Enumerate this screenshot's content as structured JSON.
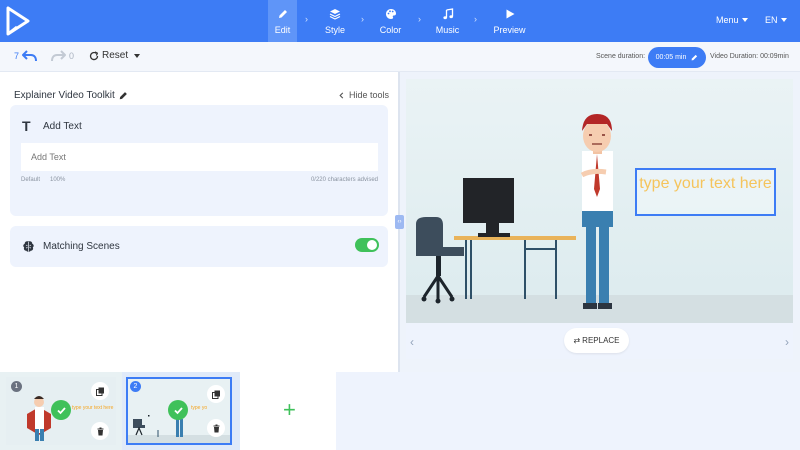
{
  "colors": {
    "brand": "#3d7cf5",
    "success": "#3fc15a",
    "textbox_text": "#f5c45c",
    "panel_bg": "#eef3fd"
  },
  "topbar": {
    "steps": [
      {
        "label": "Edit",
        "icon": "pencil-icon",
        "active": true
      },
      {
        "label": "Style",
        "icon": "layers-icon",
        "active": false
      },
      {
        "label": "Color",
        "icon": "palette-icon",
        "active": false
      },
      {
        "label": "Music",
        "icon": "music-note-icon",
        "active": false
      },
      {
        "label": "Preview",
        "icon": "play-icon",
        "active": false
      }
    ],
    "separator": "›",
    "menu_label": "Menu",
    "language_label": "EN"
  },
  "toolbar": {
    "undo_count": "7",
    "redo_count": "0",
    "reset_label": "Reset",
    "scene_duration_label": "Scene duration:",
    "scene_duration_value": "00:05 min",
    "video_duration_text": "Video Duration: 00:09min"
  },
  "panel": {
    "title": "Explainer Video Toolkit",
    "hide_tools_label": "Hide tools",
    "add_text": {
      "title": "Add Text",
      "icon_glyph": "T",
      "placeholder": "Add Text",
      "font_label": "Default",
      "zoom_label": "100%",
      "char_hint": "0/220 characters advised"
    },
    "matching_scenes": {
      "title": "Matching Scenes",
      "enabled": true
    }
  },
  "preview": {
    "textbox_text": "type your text here",
    "replace_label": "REPLACE",
    "prev_glyph": "‹",
    "next_glyph": "›"
  },
  "timeline": {
    "scenes": [
      {
        "number": "1",
        "selected": false,
        "thumb_text": "type your text here"
      },
      {
        "number": "2",
        "selected": true,
        "thumb_text": "type yo"
      }
    ],
    "add_glyph": "+"
  }
}
